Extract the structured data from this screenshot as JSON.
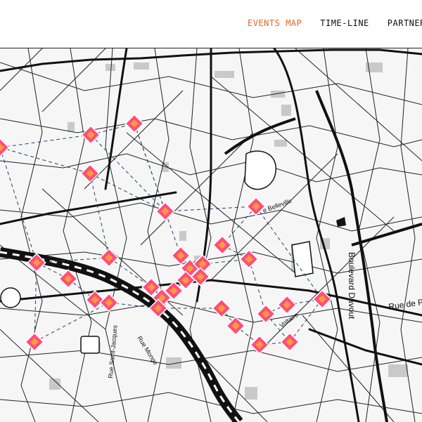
{
  "nav": {
    "items": [
      {
        "label": "EVENTS MAP",
        "active": true
      },
      {
        "label": "TIME-LINE",
        "active": false
      },
      {
        "label": "PARTNERS",
        "active": false
      }
    ]
  },
  "map": {
    "street_labels": {
      "boulevard_davout": "Boulevard Davout",
      "rue_de_pa": "Rue de Pa",
      "belleville": "e Belleville",
      "rue_monge": "Rue Monge",
      "rue_saint_jacques": "Rue Saint-Jacques",
      "voltaire": "Voltaire"
    },
    "marker_count": 30,
    "colors": {
      "accent": "#e8652b",
      "marker_outer": "#ff4d7a",
      "marker_inner": "#ff9a3c",
      "connection_line": "#2b3d6b"
    }
  }
}
